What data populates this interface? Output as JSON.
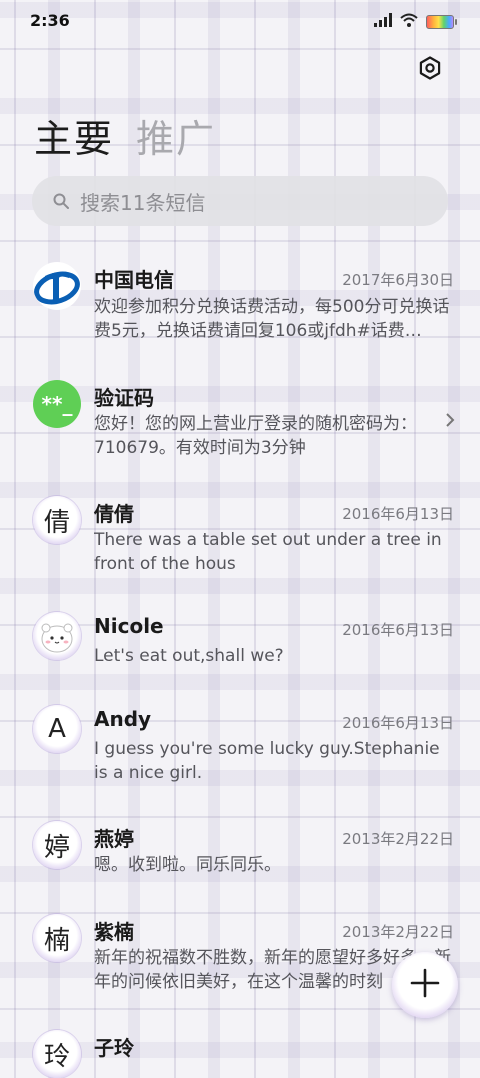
{
  "status_bar": {
    "time": "2:36",
    "signal_icon": "signal-icon",
    "wifi_icon": "wifi-icon",
    "battery_icon": "battery-icon"
  },
  "header": {
    "settings_icon": "gear-icon",
    "tabs": [
      {
        "label": "主要",
        "active": true
      },
      {
        "label": "推广",
        "active": false
      }
    ]
  },
  "search": {
    "placeholder": "搜索11条短信"
  },
  "conversations": [
    {
      "name": "中国电信",
      "date": "2017年6月30日",
      "preview": "欢迎参加积分兑换话费活动，每500分可兑换话费5元，兑换话费请回复106或jfdh#话费…",
      "avatar": "china-telecom-logo"
    },
    {
      "name": "验证码",
      "date": "",
      "preview": "您好！您的网上营业厅登录的随机密码为：710679。有效时间为3分钟",
      "avatar_text": "**_",
      "avatar_color": "#5fcf55"
    },
    {
      "name": "倩倩",
      "date": "2016年6月13日",
      "preview": "There was a table set out under a tree in front of the hous",
      "avatar_text": "倩"
    },
    {
      "name": "Nicole",
      "date": "2016年6月13日",
      "preview": "Let's eat out,shall we?",
      "avatar": "cartoon-avatar"
    },
    {
      "name": "Andy",
      "date": "2016年6月13日",
      "preview": "I guess you're some lucky guy.Stephanie is a nice girl.",
      "avatar_text": "A"
    },
    {
      "name": "燕婷",
      "date": "2013年2月22日",
      "preview": "嗯。收到啦。同乐同乐。",
      "avatar_text": "婷"
    },
    {
      "name": "紫楠",
      "date": "2013年2月22日",
      "preview": "新年的祝福数不胜数，新年的愿望好多好多，新年的问候依旧美好，在这个温馨的时刻",
      "avatar_text": "楠"
    },
    {
      "name": "子玲",
      "date": "",
      "preview": "",
      "avatar_text": "玲"
    }
  ],
  "fab": {
    "icon": "plus-icon"
  },
  "colors": {
    "accent": "#c5b3e6",
    "telecom_blue": "#0a5fb4",
    "verify_green": "#5fcf55"
  }
}
